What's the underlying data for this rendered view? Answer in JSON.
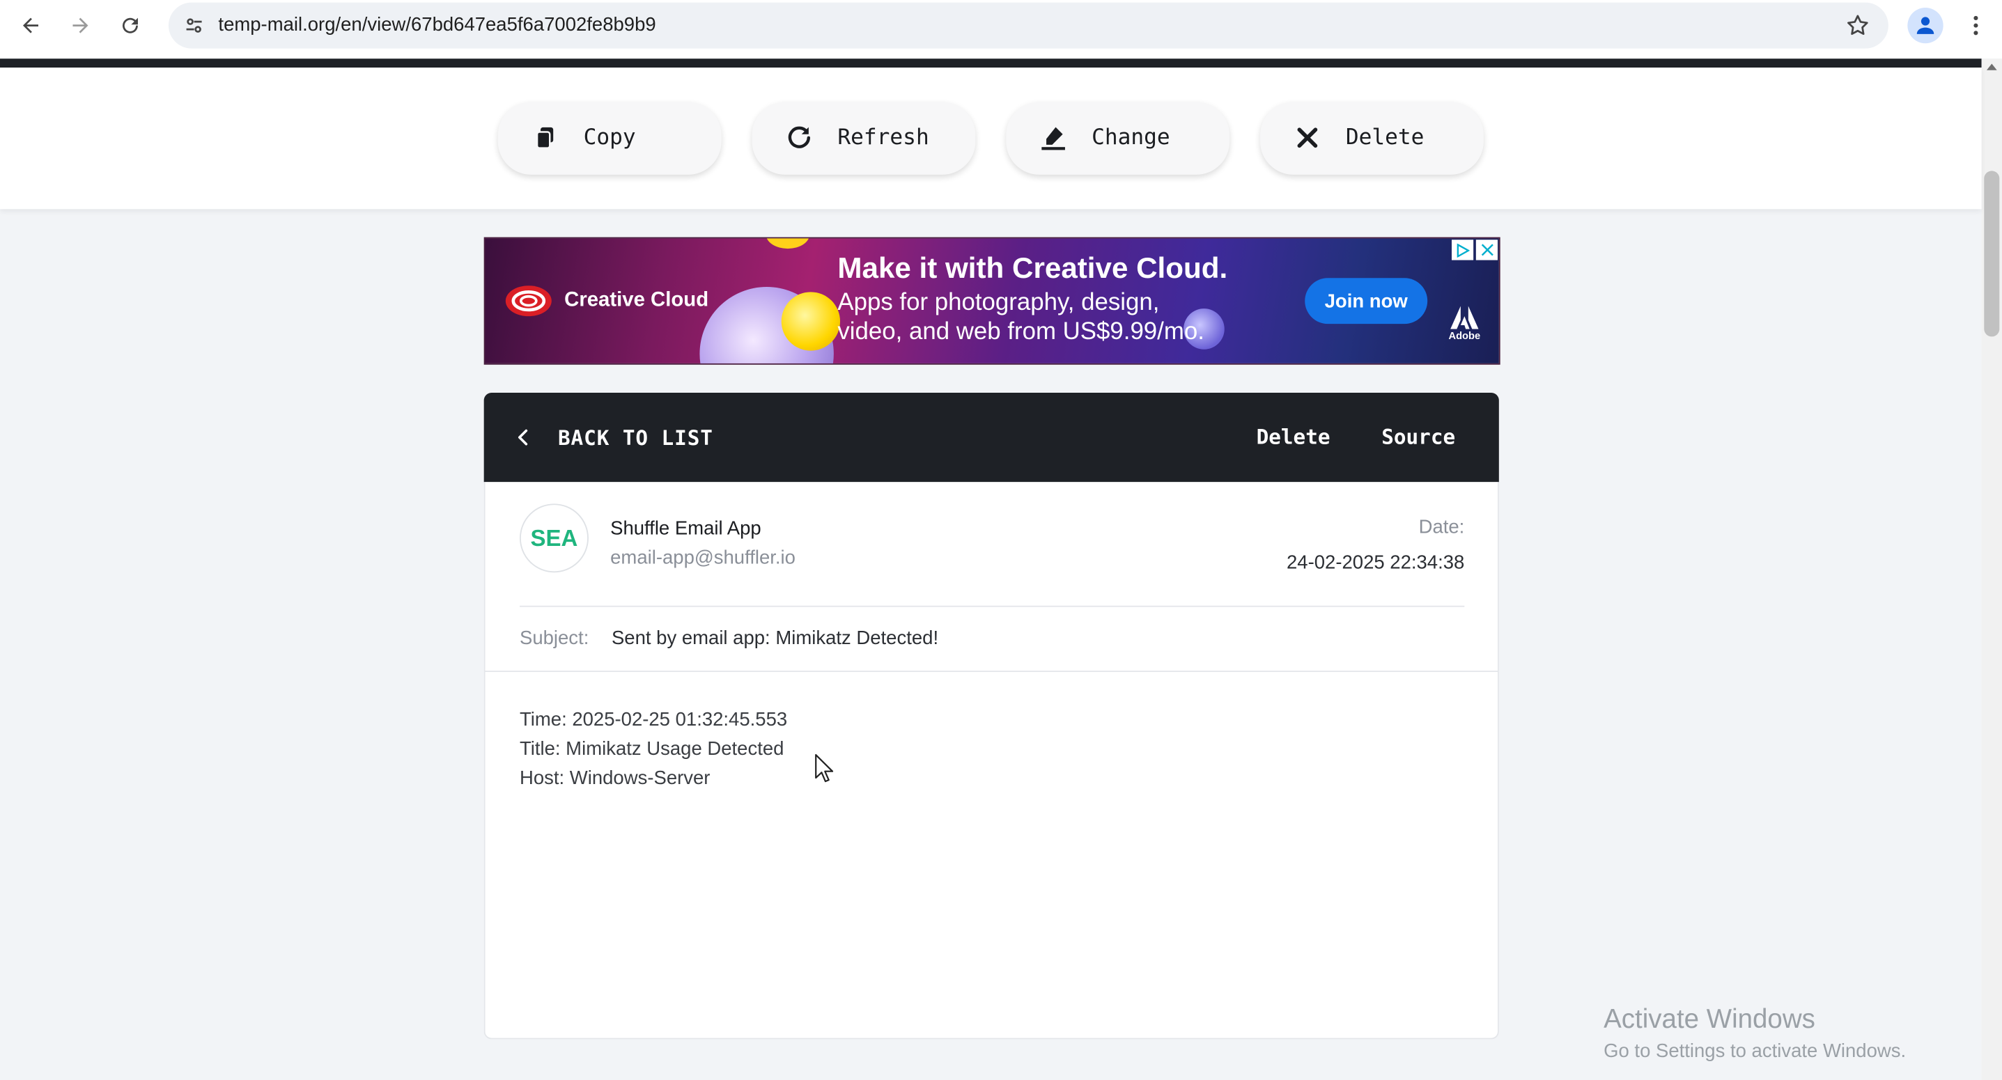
{
  "browser": {
    "url": "temp-mail.org/en/view/67bd647ea5f6a7002fe8b9b9"
  },
  "actions": {
    "copy": "Copy",
    "refresh": "Refresh",
    "change": "Change",
    "delete": "Delete"
  },
  "ad": {
    "brand": "Creative Cloud",
    "headline": "Make it with Creative Cloud.",
    "line1": "Apps for photography, design,",
    "line2": "video, and web from US$9.99/mo.",
    "cta": "Join now",
    "adobe": "Adobe"
  },
  "mail": {
    "back_label": "BACK TO LIST",
    "delete_label": "Delete",
    "source_label": "Source",
    "avatar_initials": "SEA",
    "from_name": "Shuffle Email App",
    "from_email": "email-app@shuffler.io",
    "date_label": "Date:",
    "date_value": "24-02-2025 22:34:38",
    "subject_label": "Subject:",
    "subject_value": "Sent by email app: Mimikatz Detected!",
    "body": [
      "Time: 2025-02-25 01:32:45.553",
      "Title: Mimikatz Usage Detected",
      "Host: Windows-Server"
    ]
  },
  "watermark": {
    "title": "Activate Windows",
    "subtitle": "Go to Settings to activate Windows."
  }
}
